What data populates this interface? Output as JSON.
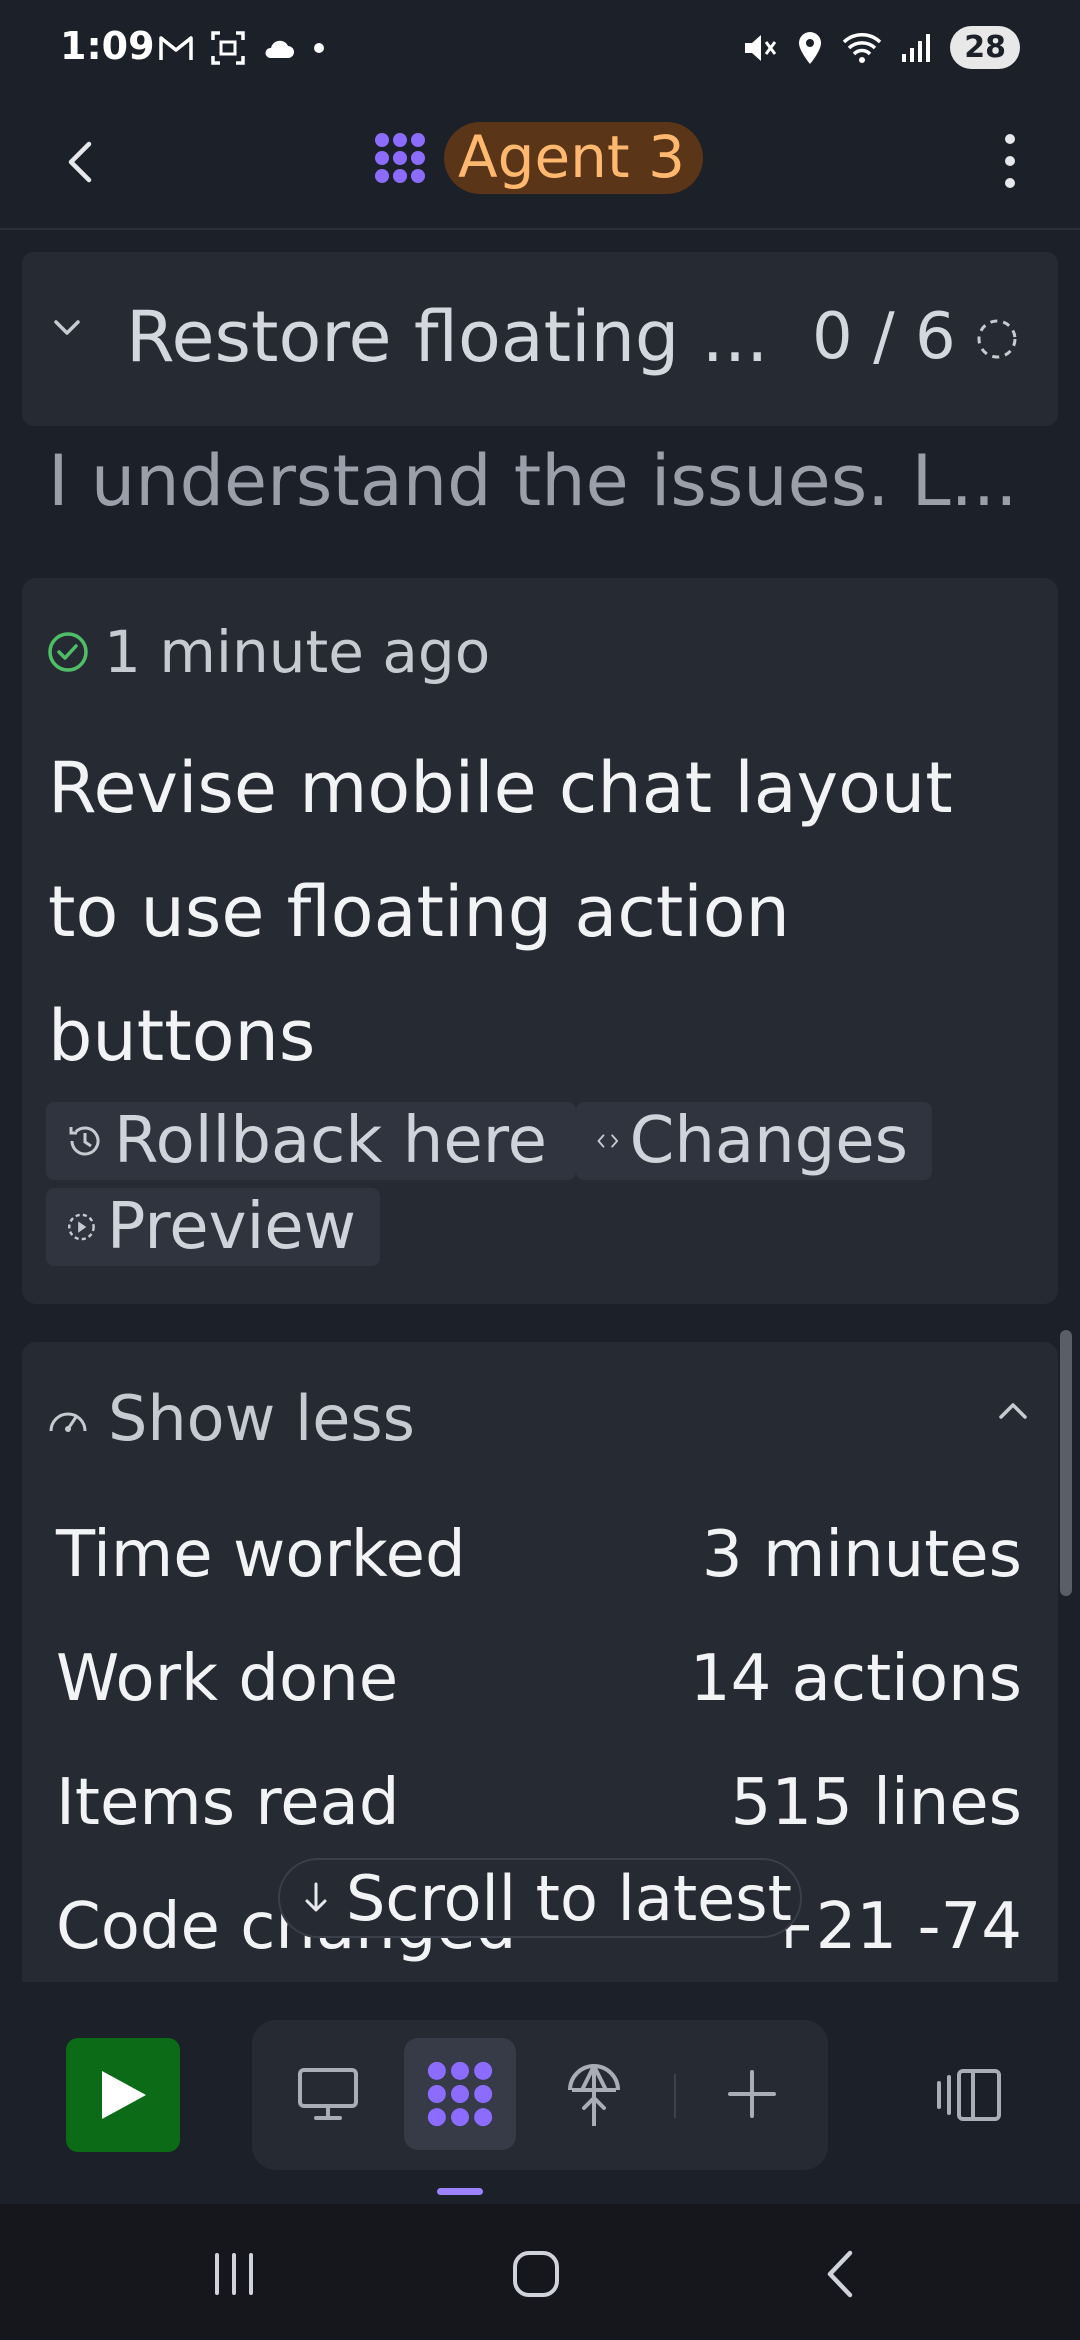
{
  "status_bar": {
    "time": "1:09",
    "left_icons": [
      "gmail-icon",
      "screenshot-icon",
      "cloud-icon",
      "dot-icon"
    ],
    "right_icons": [
      "mute-icon",
      "location-icon",
      "wifi-icon",
      "signal-icon"
    ],
    "battery": "28"
  },
  "header": {
    "agent_name": "Agent 3",
    "accent_color": "#ffb870",
    "chip_bg": "#5a3517"
  },
  "task": {
    "title": "Restore floating ...",
    "progress": "0 / 6"
  },
  "message": {
    "preview": "I understand the issues. L..."
  },
  "checkpoint": {
    "timestamp": "1 minute ago",
    "title": "Revise mobile chat layout to use floating action buttons",
    "actions": {
      "rollback": "Rollback here",
      "changes": "Changes",
      "preview": "Preview"
    }
  },
  "stats": {
    "toggle_label": "Show less",
    "rows": [
      {
        "label": "Time worked",
        "value": "3 minutes"
      },
      {
        "label": "Work done",
        "value": "14 actions"
      },
      {
        "label": "Items read",
        "value": "515 lines"
      },
      {
        "label": "Code changed",
        "value": "+21 -74"
      }
    ]
  },
  "scroll_button": {
    "label": "Scroll to latest"
  },
  "toolbar": {
    "run_color": "#0b6b16",
    "tools": [
      "desktop-icon",
      "agent-icon",
      "deploy-icon",
      "plus-icon"
    ],
    "active_tool": "agent-icon"
  }
}
